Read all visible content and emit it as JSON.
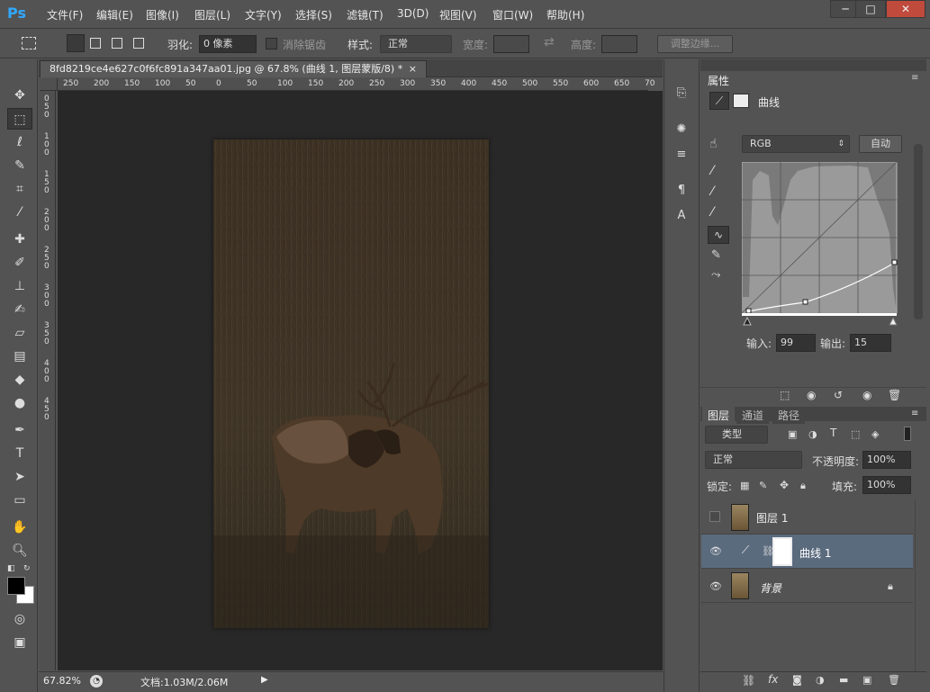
{
  "app": {
    "logo": "Ps"
  },
  "menu": [
    "文件(F)",
    "编辑(E)",
    "图像(I)",
    "图层(L)",
    "文字(Y)",
    "选择(S)",
    "滤镜(T)",
    "3D(D)",
    "视图(V)",
    "窗口(W)",
    "帮助(H)"
  ],
  "window_controls": {
    "minimize": "─",
    "maximize": "□",
    "close": "✕"
  },
  "options": {
    "feather_label": "羽化:",
    "feather_value": "0 像素",
    "antialias_label": "消除锯齿",
    "style_label": "样式:",
    "style_value": "正常",
    "width_label": "宽度:",
    "height_label": "高度:",
    "refine_edge": "调整边缘..."
  },
  "document": {
    "tab_title": "8fd8219ce4e627c0f6fc891a347aa01.jpg @ 67.8% (曲线 1, 图层蒙版/8) *",
    "tab_close": "×",
    "ruler_ticks": [
      "250",
      "200",
      "150",
      "100",
      "50",
      "0",
      "50",
      "100",
      "150",
      "200",
      "250",
      "300",
      "350",
      "400",
      "450",
      "500",
      "550",
      "600",
      "650",
      "70"
    ],
    "vruler_ticks": [
      "0",
      "5",
      "0",
      "1",
      "0",
      "0",
      "1",
      "5",
      "0",
      "2",
      "0",
      "0",
      "2",
      "5",
      "0",
      "3",
      "0",
      "0",
      "3",
      "5",
      "0",
      "4",
      "0",
      "0",
      "4",
      "5",
      "0"
    ]
  },
  "status": {
    "zoom": "67.82%",
    "doc_info": "文档:1.03M/2.06M"
  },
  "properties": {
    "tab": "属性",
    "title": "曲线",
    "channel": "RGB",
    "auto": "自动",
    "input_label": "输入:",
    "input_value": "99",
    "output_label": "输出:",
    "output_value": "15"
  },
  "layers_panel": {
    "tabs": [
      "图层",
      "通道",
      "路径"
    ],
    "kind_label": "类型",
    "blend_mode": "正常",
    "opacity_label": "不透明度:",
    "opacity_value": "100%",
    "lock_label": "锁定:",
    "fill_label": "填充:",
    "fill_value": "100%",
    "layers": [
      {
        "name": "图层 1",
        "visible": false
      },
      {
        "name": "曲线 1",
        "visible": true
      },
      {
        "name": "背景",
        "visible": true
      }
    ]
  },
  "icons": {
    "move": "move-tool-icon"
  }
}
